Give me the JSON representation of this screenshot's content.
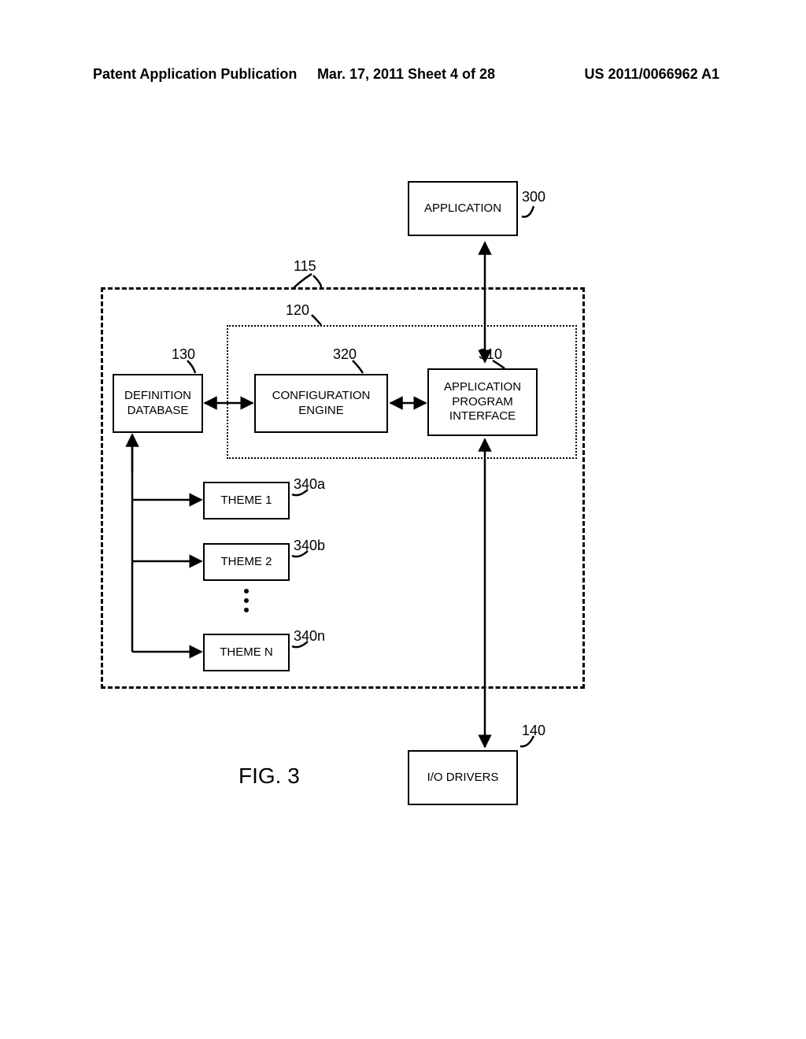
{
  "header": {
    "left": "Patent Application Publication",
    "mid": "Mar. 17, 2011  Sheet 4 of 28",
    "right": "US 2011/0066962 A1"
  },
  "refs": {
    "application": "300",
    "outer": "115",
    "inner": "120",
    "definition": "130",
    "config": "320",
    "api": "310",
    "theme1": "340a",
    "theme2": "340b",
    "themeN": "340n",
    "io": "140"
  },
  "boxes": {
    "application": "APPLICATION",
    "definition": "DEFINITION\nDATABASE",
    "config": "CONFIGURATION\nENGINE",
    "api": "APPLICATION\nPROGRAM\nINTERFACE",
    "theme1": "THEME 1",
    "theme2": "THEME 2",
    "themeN": "THEME N",
    "io": "I/O DRIVERS"
  },
  "figure": "FIG. 3"
}
